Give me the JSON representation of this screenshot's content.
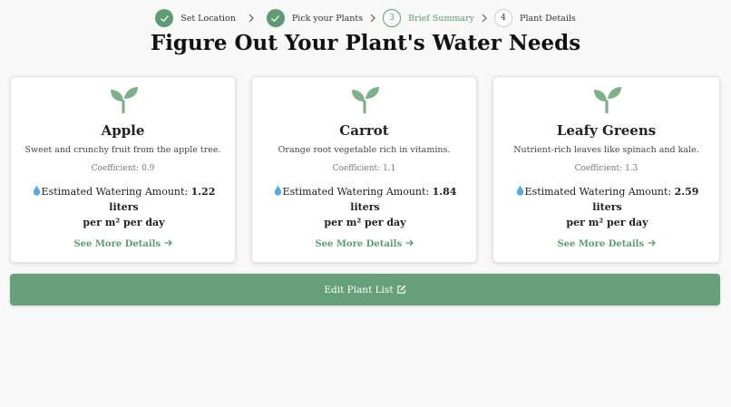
{
  "stepper": {
    "steps": [
      {
        "label": "Set Location",
        "state": "done",
        "number": ""
      },
      {
        "label": "Pick your Plants",
        "state": "done",
        "number": ""
      },
      {
        "label": "Brief Summary",
        "state": "current",
        "number": "3"
      },
      {
        "label": "Plant Details",
        "state": "future",
        "number": "4"
      }
    ]
  },
  "page_title": "Figure Out Your Plant's Water Needs",
  "plants": [
    {
      "name": "Apple",
      "description": "Sweet and crunchy fruit from the apple tree.",
      "coefficient": "Coefficient: 0.9",
      "water_label": "Estimated Watering Amount:",
      "water_amount": "1.22 liters",
      "water_unit": "per m² per day",
      "more_label": "See More Details"
    },
    {
      "name": "Carrot",
      "description": "Orange root vegetable rich in vitamins.",
      "coefficient": "Coefficient: 1.1",
      "water_label": "Estimated Watering Amount:",
      "water_amount": "1.84 liters",
      "water_unit": "per m² per day",
      "more_label": "See More Details"
    },
    {
      "name": "Leafy Greens",
      "description": "Nutrient-rich leaves like spinach and kale.",
      "coefficient": "Coefficient: 1.3",
      "water_label": "Estimated Watering Amount:",
      "water_amount": "2.59 liters",
      "water_unit": "per m² per day",
      "more_label": "See More Details"
    }
  ],
  "edit_button_label": "Edit Plant List",
  "icons": {
    "step_done": "check-icon",
    "step_separator": "chevron-right-icon",
    "plant": "sprout-icon",
    "water": "water-drop-icon",
    "more": "arrow-right-icon",
    "edit": "edit-icon"
  },
  "colors": {
    "accent": "#5e9a73",
    "button": "#66a07a",
    "background": "#f8f8f8"
  }
}
